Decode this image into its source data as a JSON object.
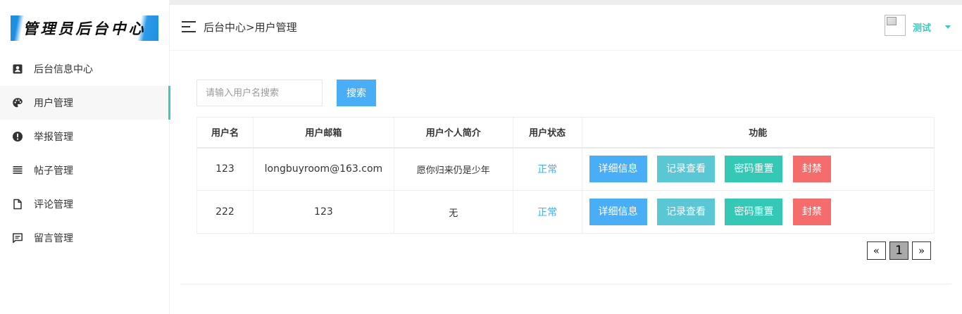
{
  "sidebar": {
    "logo_text": "管理员后台中心",
    "items": [
      {
        "label": "后台信息中心",
        "icon": "user-card-icon"
      },
      {
        "label": "用户管理",
        "icon": "palette-icon",
        "active": true
      },
      {
        "label": "举报管理",
        "icon": "alert-circle-icon"
      },
      {
        "label": "帖子管理",
        "icon": "list-icon"
      },
      {
        "label": "评论管理",
        "icon": "document-icon"
      },
      {
        "label": "留言管理",
        "icon": "message-icon"
      }
    ]
  },
  "header": {
    "breadcrumb": "后台中心>用户管理",
    "user_name": "测试",
    "menu_icon": "hamburger-icon"
  },
  "search": {
    "placeholder": "请输入用户名搜索",
    "value": "",
    "button_label": "搜索"
  },
  "table": {
    "columns": [
      "用户名",
      "用户邮箱",
      "用户个人简介",
      "用户状态",
      "功能"
    ],
    "rows": [
      {
        "username": "123",
        "email": "longbuyroom@163.com",
        "bio": "愿你归来仍是少年",
        "status": "正常"
      },
      {
        "username": "222",
        "email": "123",
        "bio": "无",
        "status": "正常"
      }
    ],
    "actions": {
      "detail": "详细信息",
      "records": "记录查看",
      "reset": "密码重置",
      "ban": "封禁"
    }
  },
  "pagination": {
    "prev": "«",
    "current": "1",
    "next": "»"
  },
  "colors": {
    "accent_teal": "#3ec8c0",
    "primary_blue": "#4aaef6",
    "info_cyan": "#5bc6d4",
    "success_teal": "#35c9b5",
    "danger_red": "#f56c6c"
  }
}
